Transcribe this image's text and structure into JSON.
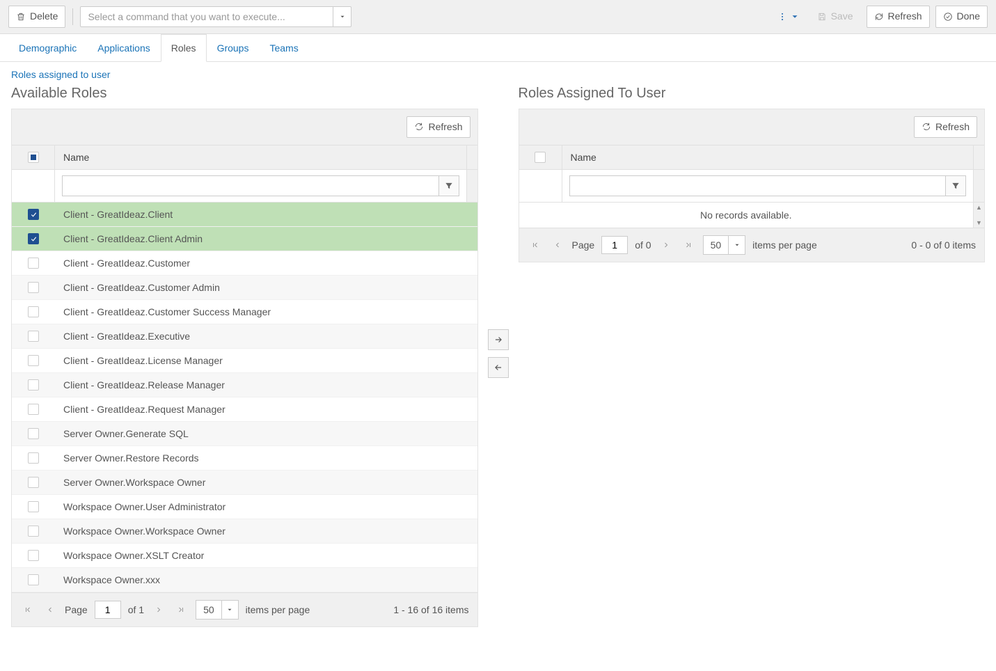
{
  "toolbar": {
    "delete_label": "Delete",
    "command_placeholder": "Select a command that you want to execute...",
    "save_label": "Save",
    "refresh_label": "Refresh",
    "done_label": "Done"
  },
  "tabs": [
    {
      "label": "Demographic"
    },
    {
      "label": "Applications"
    },
    {
      "label": "Roles"
    },
    {
      "label": "Groups"
    },
    {
      "label": "Teams"
    }
  ],
  "active_tab_index": 2,
  "breadcrumb_link": "Roles assigned to user",
  "left": {
    "title": "Available Roles",
    "refresh_label": "Refresh",
    "col_name": "Name",
    "rows": [
      {
        "name": "Client - GreatIdeaz.Client",
        "checked": true
      },
      {
        "name": "Client - GreatIdeaz.Client Admin",
        "checked": true
      },
      {
        "name": "Client - GreatIdeaz.Customer",
        "checked": false
      },
      {
        "name": "Client - GreatIdeaz.Customer Admin",
        "checked": false
      },
      {
        "name": "Client - GreatIdeaz.Customer Success Manager",
        "checked": false
      },
      {
        "name": "Client - GreatIdeaz.Executive",
        "checked": false
      },
      {
        "name": "Client - GreatIdeaz.License Manager",
        "checked": false
      },
      {
        "name": "Client - GreatIdeaz.Release Manager",
        "checked": false
      },
      {
        "name": "Client - GreatIdeaz.Request Manager",
        "checked": false
      },
      {
        "name": "Server Owner.Generate SQL",
        "checked": false
      },
      {
        "name": "Server Owner.Restore Records",
        "checked": false
      },
      {
        "name": "Server Owner.Workspace Owner",
        "checked": false
      },
      {
        "name": "Workspace Owner.User Administrator",
        "checked": false
      },
      {
        "name": "Workspace Owner.Workspace Owner",
        "checked": false
      },
      {
        "name": "Workspace Owner.XSLT Creator",
        "checked": false
      },
      {
        "name": "Workspace Owner.xxx",
        "checked": false
      }
    ],
    "pager": {
      "page_label": "Page",
      "page_value": "1",
      "of_label": "of 1",
      "size_value": "50",
      "items_label": "items per page",
      "summary": "1 - 16 of 16 items"
    }
  },
  "right": {
    "title": "Roles Assigned To User",
    "refresh_label": "Refresh",
    "col_name": "Name",
    "no_records": "No records available.",
    "pager": {
      "page_label": "Page",
      "page_value": "1",
      "of_label": "of 0",
      "size_value": "50",
      "items_label": "items per page",
      "summary": "0 - 0 of 0 items"
    }
  }
}
